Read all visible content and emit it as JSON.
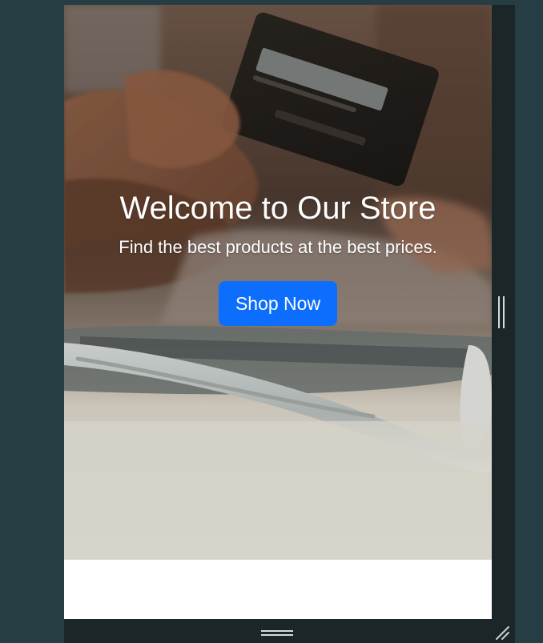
{
  "hero": {
    "title": "Welcome to Our Store",
    "subtitle": "Find the best products at the best prices.",
    "cta_label": "Shop Now",
    "image_subject": "hand-holding-credit-card-over-laptop"
  },
  "colors": {
    "workspace_background": "#263d44",
    "device_frame": "#1b2629",
    "cta_background": "#0d6efd",
    "cta_text": "#ffffff",
    "hero_text": "#ffffff",
    "viewport_background": "#ffffff"
  },
  "icons": {
    "right_handle": "vertical-resize-handle-icon",
    "bottom_handle": "horizontal-resize-handle-icon",
    "corner_grip": "resize-corner-icon"
  }
}
